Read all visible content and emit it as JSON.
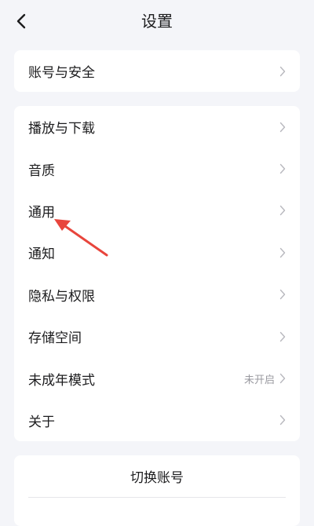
{
  "header": {
    "title": "设置",
    "back_icon": "chevron-left-icon"
  },
  "account_card": {
    "items": [
      {
        "label": "账号与安全"
      }
    ]
  },
  "settings_card": {
    "items": [
      {
        "label": "播放与下载"
      },
      {
        "label": "音质"
      },
      {
        "label": "通用"
      },
      {
        "label": "通知"
      },
      {
        "label": "隐私与权限"
      },
      {
        "label": "存储空间"
      },
      {
        "label": "未成年模式",
        "status": "未开启"
      },
      {
        "label": "关于"
      }
    ]
  },
  "switch_card": {
    "switch_label": "切换账号"
  },
  "annotation": {
    "color": "#e8453c",
    "points_to": "通用"
  },
  "colors": {
    "background": "#f4f5f9",
    "card": "#ffffff",
    "chevron": "#b8b8be"
  }
}
